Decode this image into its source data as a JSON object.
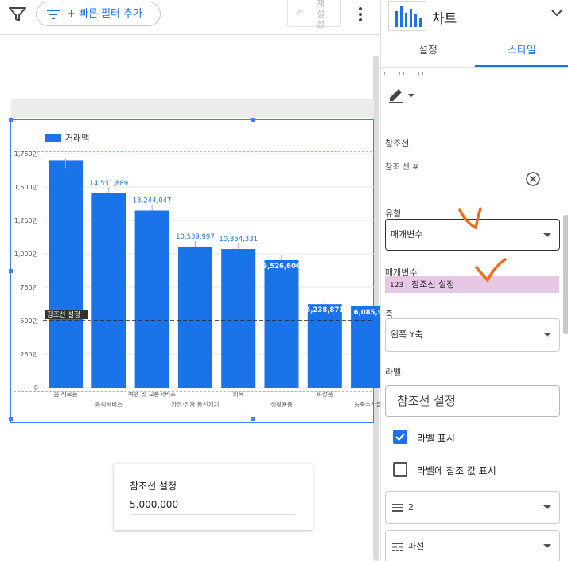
{
  "toolbar": {
    "quick_filter_label": "+ 빠른 필터 추가",
    "reset_label": "재설정"
  },
  "chart": {
    "legend_label": "거래액",
    "ref_line_text": "참조선 설정"
  },
  "chart_data": {
    "type": "bar",
    "series": [
      {
        "name": "거래액",
        "values": [
          1700,
          1453.1889,
          1324.4047,
          1053.9997,
          1035.4331,
          952.66,
          623.8871,
          608.5
        ]
      }
    ],
    "categories": [
      "음·식료품",
      "음식서비스",
      "여행 및 교통서비스",
      "가전·전자·통신기기",
      "의복",
      "생활용품",
      "화장품",
      "농축수산물"
    ],
    "data_labels": [
      "",
      "14,531,889",
      "13,244,047",
      "10,539,997",
      "10,354,331",
      "9,526,600",
      "6,238,871",
      "6,085,9"
    ],
    "y_ticks": [
      "0",
      "250만",
      "500만",
      "750만",
      "1,000만",
      "1,250만",
      "1,500만",
      "1,750만"
    ],
    "ylim": [
      0,
      1750
    ],
    "reference_line": {
      "value": 500,
      "label": "참조선 설정",
      "style": "dashed"
    },
    "bar_color": "#1a73e8"
  },
  "ref_card": {
    "title": "참조선 설정",
    "value": "5,000,000"
  },
  "panel": {
    "title": "차트",
    "tabs": {
      "setup": "설정",
      "style": "스타일"
    },
    "reference_line_header": "참조선",
    "reference_line_number": "참조 선 #",
    "type_label": "유형",
    "type_value": "매개변수",
    "parameter_label": "매개변수",
    "parameter_chip_icon": "123",
    "parameter_value": "참조선 설정",
    "axis_label": "축",
    "axis_value": "왼쪽 Y축",
    "labels_label": "라벨",
    "label_input_value": "참조선 설정",
    "show_label": "라벨 표시",
    "show_ref_value": "라벨에 참조 값 표시",
    "line_weight": "2",
    "line_style": "파선"
  },
  "colors": {
    "accent": "#1a73e8",
    "chip": "#e7c8e4",
    "annotation": "#f26b1d"
  }
}
